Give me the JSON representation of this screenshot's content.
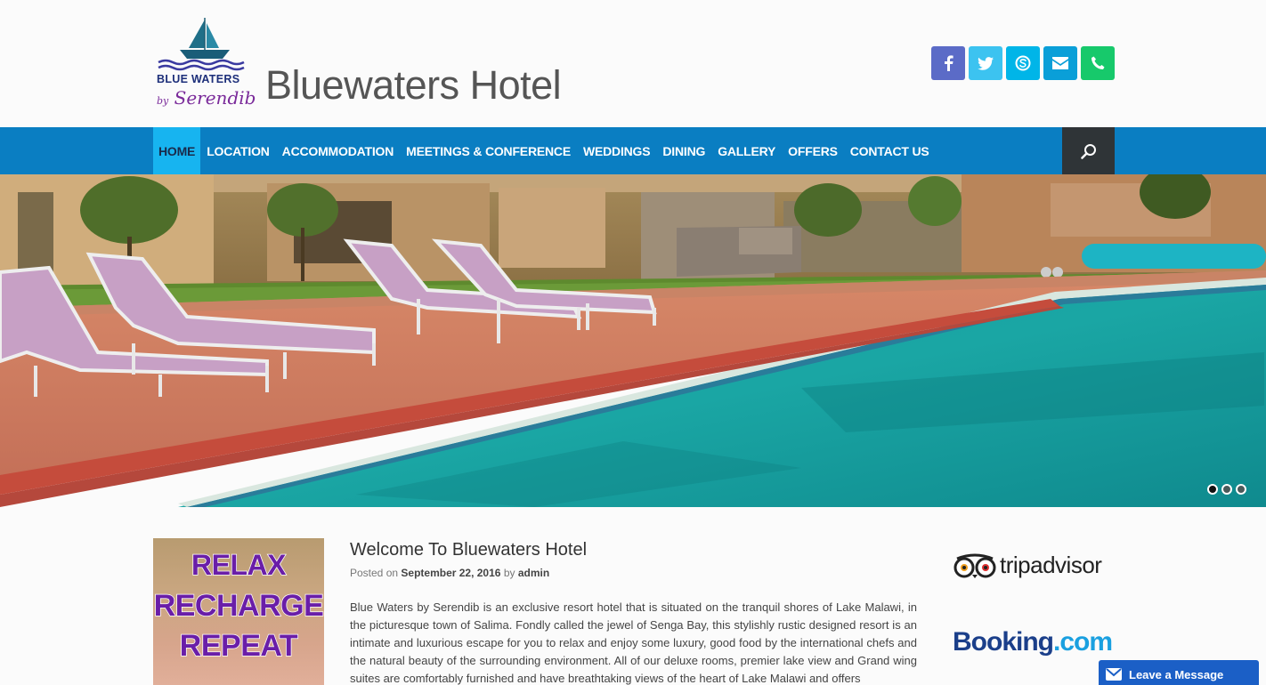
{
  "header": {
    "logo_line1": "BLUE WATERS",
    "logo_by": "by",
    "logo_line2": "Serendib",
    "site_title": "Bluewaters Hotel"
  },
  "social": [
    {
      "name": "facebook",
      "glyph": "f",
      "color": "#5b6bc7"
    },
    {
      "name": "twitter",
      "glyph": "t",
      "color": "#3cc3f0"
    },
    {
      "name": "skype",
      "glyph": "S",
      "color": "#00b5e8"
    },
    {
      "name": "email",
      "glyph": "✉",
      "color": "#0a9fd8"
    },
    {
      "name": "phone",
      "glyph": "✆",
      "color": "#17c96b"
    }
  ],
  "nav": {
    "items": [
      "HOME",
      "LOCATION",
      "ACCOMMODATION",
      "MEETINGS & CONFERENCE",
      "WEDDINGS",
      "DINING",
      "GALLERY",
      "OFFERS",
      "CONTACT US"
    ],
    "active_index": 0,
    "search_icon": "search-icon"
  },
  "slider": {
    "slide_count": 3,
    "active_slide": 1
  },
  "promo": {
    "line1": "RELAX",
    "line2": "RECHARGE",
    "line3": "REPEAT"
  },
  "post": {
    "title": "Welcome To Bluewaters Hotel",
    "posted_on_label": "Posted on",
    "date": "September 22, 2016",
    "by_label": "by",
    "author": "admin",
    "body": "Blue Waters by Serendib is an exclusive resort hotel that is situated on the tranquil shores of Lake Malawi, in the picturesque town of Salima. Fondly called the jewel of Senga Bay, this stylishly rustic designed resort is an intimate and luxurious escape for you to relax and enjoy some luxury, good food by the international chefs and the natural beauty of the surrounding environment. All of our deluxe rooms, premier lake view and Grand wing suites are comfortably furnished and have breathtaking views of the heart of Lake Malawi and offers"
  },
  "sidebar": {
    "tripadvisor_text": "tripadvisor",
    "booking_main": "Booking",
    "booking_tld": ".com"
  },
  "chat": {
    "label": "Leave a Message"
  }
}
